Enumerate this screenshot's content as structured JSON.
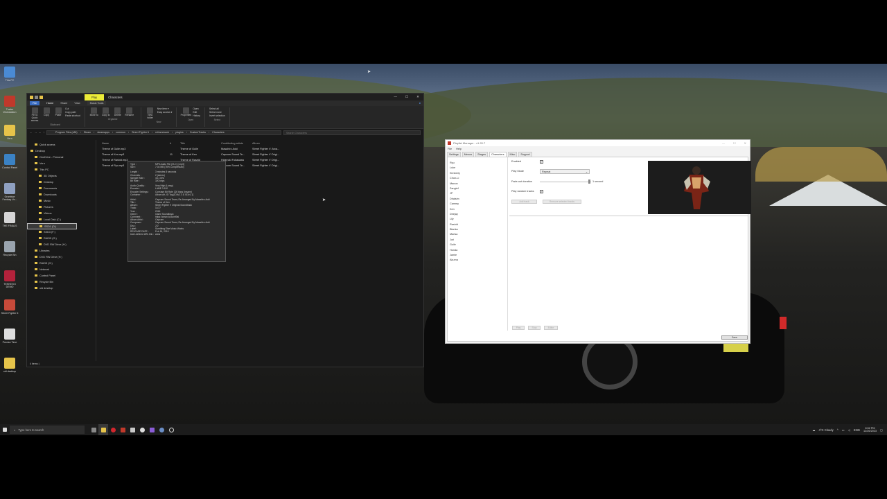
{
  "desktop_icons": [
    {
      "label": "This PC",
      "color": "#4a8ad4"
    },
    {
      "label": "Trader Workstation",
      "color": "#c0392b"
    },
    {
      "label": "Vern",
      "color": "#e6c44a"
    },
    {
      "label": "Control Panel",
      "color": "#3b82c4"
    },
    {
      "label": "Granblue Fantasy Ve...",
      "color": "#8fa0c0"
    },
    {
      "label": "THE FINALS",
      "color": "#d6d6d6"
    },
    {
      "label": "Recycle Bin",
      "color": "#9aa4ae"
    },
    {
      "label": "TEKKEN 8 DEMO",
      "color": "#b3223b"
    },
    {
      "label": "Street Fighter 6",
      "color": "#c74a3a"
    },
    {
      "label": "Precise Time",
      "color": "#dddddd"
    },
    {
      "label": "old desktop",
      "color": "#e6c44a"
    }
  ],
  "explorer": {
    "title_tab_play": "Play",
    "title": "Characters",
    "window_buttons": [
      "—",
      "☐",
      "✕"
    ],
    "ribbon_tabs": [
      "File",
      "Home",
      "Share",
      "View",
      "Music Tools"
    ],
    "ribbon_groups": [
      {
        "items": [
          "Pin to Quick access",
          "Copy",
          "Paste"
        ],
        "subitems": [
          "Cut",
          "Copy path",
          "Paste shortcut"
        ],
        "label": "Clipboard"
      },
      {
        "items": [
          "Move to",
          "Copy to",
          "Delete",
          "Rename"
        ],
        "subitems": [],
        "label": "Organise"
      },
      {
        "items": [
          "New folder"
        ],
        "subitems": [
          "New item ▾",
          "Easy access ▾"
        ],
        "label": "New"
      },
      {
        "items": [
          "Properties"
        ],
        "subitems": [
          "Open",
          "Edit",
          "History"
        ],
        "label": "Open"
      },
      {
        "items": [],
        "subitems": [
          "Select all",
          "Select none",
          "Invert selection"
        ],
        "label": "Select"
      }
    ],
    "breadcrumb": [
      "Program Files (x86)",
      "Steam",
      "steamapps",
      "common",
      "Street Fighter 6",
      "reframework",
      "plugins",
      "CustomTracks",
      "Characters"
    ],
    "search_placeholder": "Search Characters",
    "nav": [
      {
        "label": "Quick access",
        "indent": 1
      },
      {
        "label": "Desktop",
        "indent": 0
      },
      {
        "label": "OneDrive - Personal",
        "indent": 1
      },
      {
        "label": "Vern",
        "indent": 1
      },
      {
        "label": "This PC",
        "indent": 1
      },
      {
        "label": "3D Objects",
        "indent": 2
      },
      {
        "label": "Desktop",
        "indent": 2
      },
      {
        "label": "Documents",
        "indent": 2
      },
      {
        "label": "Downloads",
        "indent": 2
      },
      {
        "label": "Music",
        "indent": 2
      },
      {
        "label": "Pictures",
        "indent": 2
      },
      {
        "label": "Videos",
        "indent": 2
      },
      {
        "label": "Local Disk (C:)",
        "indent": 2
      },
      {
        "label": "SSD1 (D:)",
        "indent": 2,
        "selected": true
      },
      {
        "label": "SSD2 (E:)",
        "indent": 2
      },
      {
        "label": "SSD3 (F:)",
        "indent": 2
      },
      {
        "label": "RAID5 (G:)",
        "indent": 2
      },
      {
        "label": "DVD RW Drive (H:)",
        "indent": 2
      },
      {
        "label": "Libraries",
        "indent": 1
      },
      {
        "label": "DVD RW Drive (H:)",
        "indent": 1
      },
      {
        "label": "RAID5 (G:)",
        "indent": 1
      },
      {
        "label": "Network",
        "indent": 1
      },
      {
        "label": "Control Panel",
        "indent": 1
      },
      {
        "label": "Recycle Bin",
        "indent": 1
      },
      {
        "label": "old desktop",
        "indent": 1
      }
    ],
    "columns": [
      "Name",
      "#",
      "Title",
      "Contributing artists",
      "Album"
    ],
    "rows": [
      [
        "Theme of Guile.mp3",
        "",
        "Theme of Guile",
        "Masahiro Aoki",
        "Street Fighter V: Arca..."
      ],
      [
        "Theme of Ken.mp3",
        "11",
        "Theme of Ken",
        "Capcom Sound Te...",
        "Street Fighter V Origi..."
      ],
      [
        "Theme of Rashid.mp3",
        "",
        "Theme of Rashid",
        "Hideyuki Fukasawa",
        "Street Fighter V Origi..."
      ],
      [
        "Theme of Ryu.mp3",
        "",
        "Theme of Ryu",
        "Capcom Sound Te...",
        "Street Fighter V Origi..."
      ]
    ],
    "tooltip": [
      [
        "Type :",
        "MP3 Audio File (VLC)  [.mp3]"
      ],
      [
        "Size :",
        "7.04 MB  (76% Compressed)"
      ],
      [
        "Length :",
        "3 minutes 8 seconds",
        true
      ],
      [
        "Channels :",
        "2  (stereo)"
      ],
      [
        "Sample Rate :",
        "44.1 kHz"
      ],
      [
        "Bit Rate :",
        "320 kbps"
      ],
      [
        "Audio Quality :",
        "Very High (Lossy)",
        true
      ],
      [
        "Encoder :",
        "LAME 3.100"
      ],
      [
        "Encoder Settings :",
        "Constant Bit Rate 320 kbps  (Insane)"
      ],
      [
        "Container :",
        "Album Art, ID Tag [ID3v2.3 & ID3v1.1]"
      ],
      [
        "Artist :",
        "Capcom Sound Team; Re-Arranged By Masahiro Aoki",
        true
      ],
      [
        "Title :",
        "Theme of Ken"
      ],
      [
        "Album :",
        "Street Fighter V Original Soundtrack"
      ],
      [
        "Track :",
        "11/27"
      ],
      [
        "Year :",
        "2016"
      ],
      [
        "Genre :",
        "Game Soundtrack"
      ],
      [
        "Comment :",
        "https://amzn.to/3oml9al"
      ],
      [
        "Album Artist :",
        "Capcom"
      ],
      [
        "Composer :",
        "Capcom Sound Team; Re-Arranged By Masahiro Aoki"
      ],
      [
        "Disc :",
        "2/2"
      ],
      [
        "Label :",
        "Sumthing Else Music Works"
      ],
      [
        "RELEASE DATE :",
        "Feb 16, 2016"
      ],
      [
        "User-defined URL link :",
        "www"
      ]
    ],
    "status": "4 items  |"
  },
  "playlist": {
    "title": "Playlist Manager - v1.20.7",
    "menu": [
      "File",
      "Help"
    ],
    "tabs": [
      "Settings",
      "Menus",
      "Stages",
      "Characters",
      "Misc",
      "Support"
    ],
    "active_tab": "Characters",
    "characters": [
      "Ryu",
      "Luke",
      "Kimberly",
      "Chun-Li",
      "Manon",
      "Zangief",
      "JP",
      "Dhalsim",
      "Cammy",
      "Ken",
      "Deejay",
      "Lily",
      "Rashid",
      "Blanka",
      "Marisa",
      "Juri",
      "Guile",
      "Honda",
      "Jamie",
      "Akuma"
    ],
    "enabled_label": "Enabled",
    "play_mode_label": "Play Mode",
    "play_mode_value": "Repeat",
    "fade_label": "Fade-out duration",
    "fade_value": "1 second",
    "fade_fraction": 0.97,
    "random_label": "Play random tracks",
    "add_track": "Add track",
    "remove_tracks": "Remove selected tracks",
    "play": "Play",
    "stop": "Stop",
    "editor": "Editor",
    "save": "Save"
  },
  "taskbar": {
    "search_placeholder": "Type here to search",
    "weather": "4°C  Cloudy",
    "lang": "ENG",
    "time": "8:52 PM",
    "date": "12/26/2023"
  }
}
